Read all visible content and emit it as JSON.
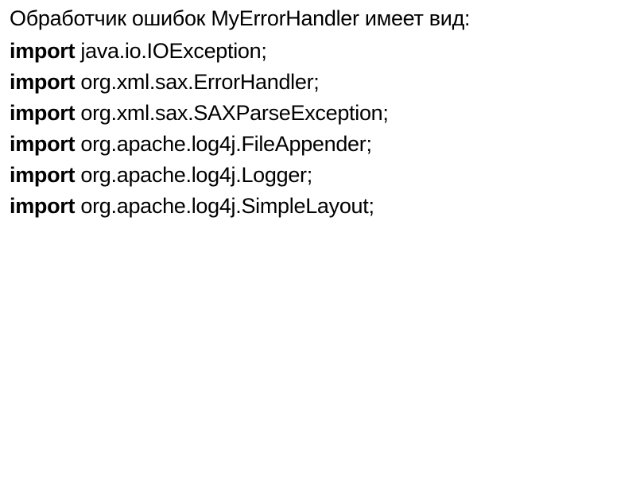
{
  "title": "Обработчик ошибок MyErrorHandler имеет вид:",
  "lines": [
    {
      "keyword": "import",
      "rest": " java.io.IOException;"
    },
    {
      "keyword": "import",
      "rest": " org.xml.sax.ErrorHandler;"
    },
    {
      "keyword": "import",
      "rest": " org.xml.sax.SAXParseException;"
    },
    {
      "keyword": "import",
      "rest": " org.apache.log4j.FileAppender;"
    },
    {
      "keyword": "import",
      "rest": " org.apache.log4j.Logger;"
    },
    {
      "keyword": "import",
      "rest": " org.apache.log4j.SimpleLayout;"
    }
  ]
}
